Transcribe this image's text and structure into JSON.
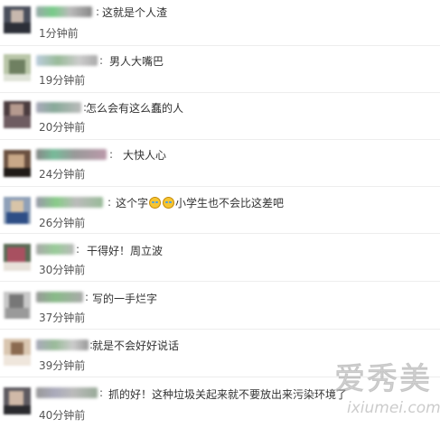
{
  "colors": {
    "text": "#333333",
    "time": "#555555",
    "divider": "#ededed",
    "background": "#ffffff"
  },
  "comments": [
    {
      "text": "这就是个人渣",
      "time": "1分钟前"
    },
    {
      "text": "男人大嘴巴",
      "time": "19分钟前"
    },
    {
      "text": "怎么会有这么蠢的人",
      "time": "20分钟前"
    },
    {
      "text": "大快人心",
      "time": "24分钟前"
    },
    {
      "text_before": "这个字",
      "emoji": "laugh-cry-icon",
      "text_after": "小学生也不会比这差吧",
      "time": "26分钟前"
    },
    {
      "text": "干得好！周立波",
      "time": "30分钟前"
    },
    {
      "text": "写的一手烂字",
      "time": "37分钟前"
    },
    {
      "text": "就是不会好好说话",
      "time": "39分钟前"
    },
    {
      "text": "抓的好！这种垃圾关起来就不要放出来污染环境了",
      "time": "40分钟前"
    }
  ],
  "watermark": {
    "cn": "爱秀美",
    "en": "ixiumei.com"
  }
}
